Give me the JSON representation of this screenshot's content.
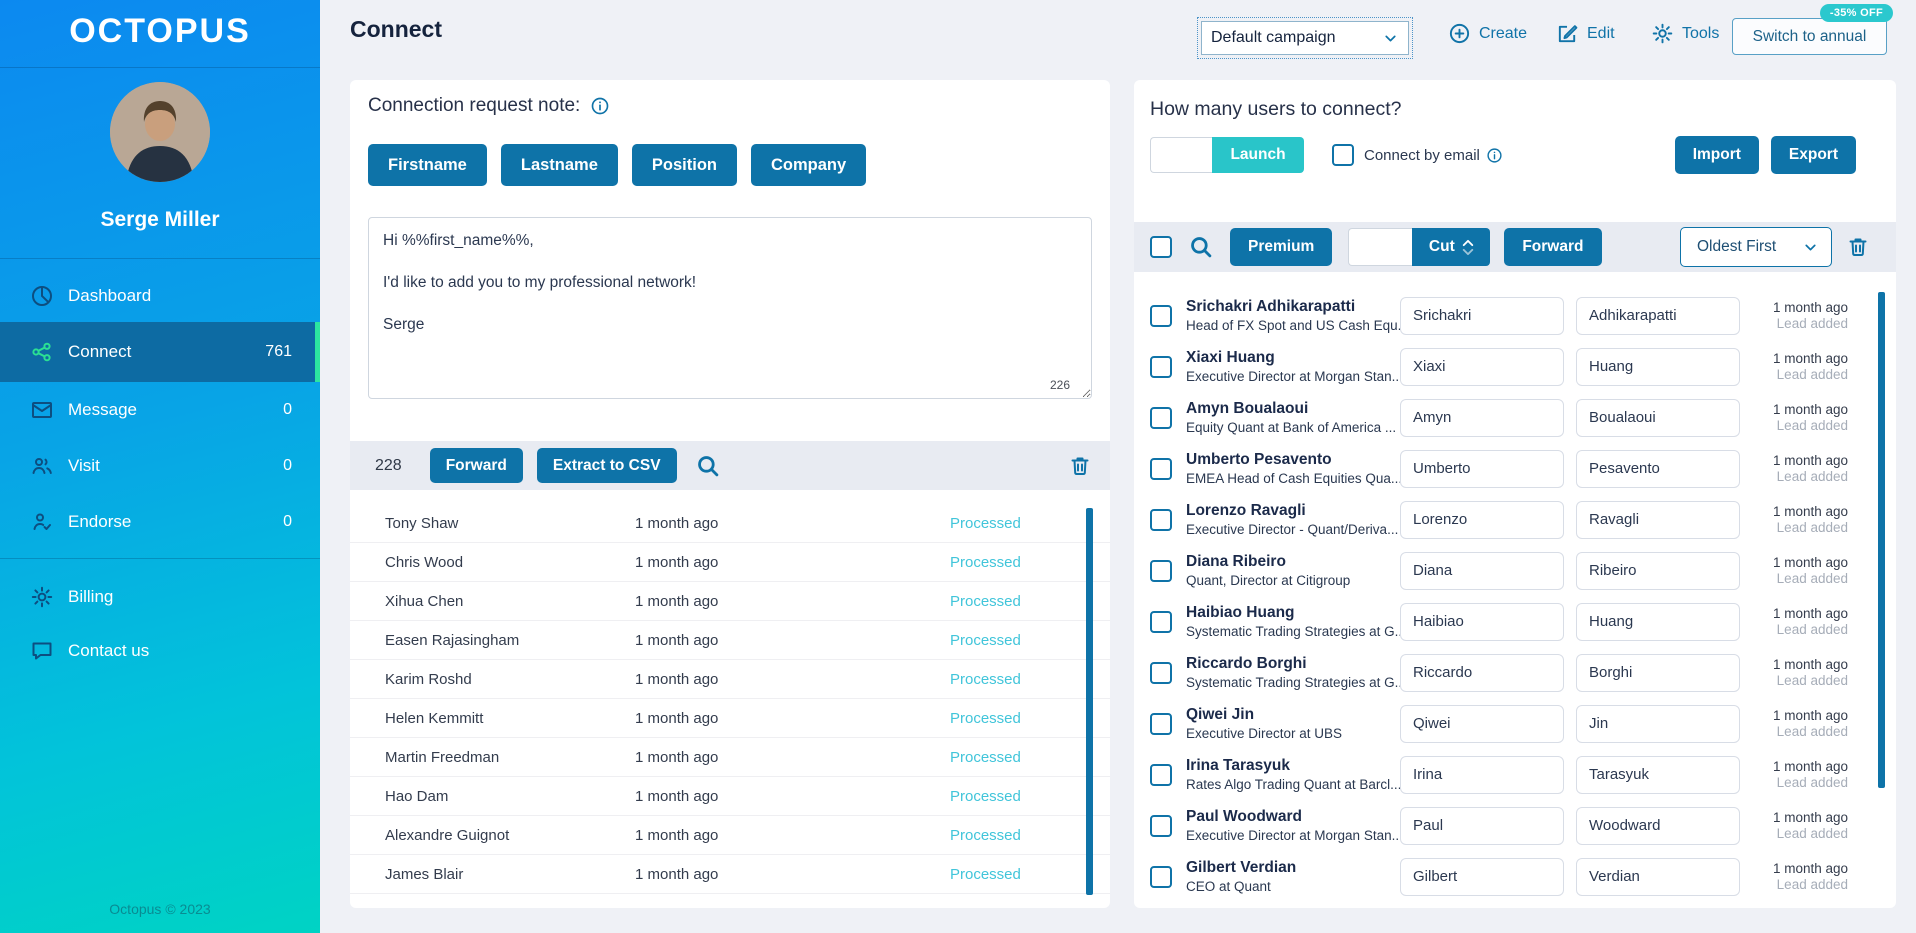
{
  "app": {
    "logo": "OCTOPUS",
    "footer": "Octopus © 2023"
  },
  "sidebar": {
    "user": "Serge Miller",
    "items": [
      {
        "label": "Dashboard",
        "count": ""
      },
      {
        "label": "Connect",
        "count": "761"
      },
      {
        "label": "Message",
        "count": "0"
      },
      {
        "label": "Visit",
        "count": "0"
      },
      {
        "label": "Endorse",
        "count": "0"
      }
    ],
    "secondary": [
      {
        "label": "Billing"
      },
      {
        "label": "Contact us"
      }
    ]
  },
  "header": {
    "title": "Connect",
    "campaign_select": "Default campaign",
    "create_label": "Create",
    "edit_label": "Edit",
    "tools_label": "Tools",
    "switch_annual_label": "Switch to annual",
    "discount_badge": "-35% OFF"
  },
  "note_panel": {
    "title": "Connection request note:",
    "variables": [
      "Firstname",
      "Lastname",
      "Position",
      "Company"
    ],
    "message": "Hi %%first_name%%,\n\nI'd like to add you to my professional network!\n\nSerge",
    "char_count": "226"
  },
  "processed_panel": {
    "count": "228",
    "forward_label": "Forward",
    "extract_label": "Extract to CSV",
    "rows": [
      {
        "name": "Tony Shaw",
        "time": "1 month ago",
        "status": "Processed"
      },
      {
        "name": "Chris Wood",
        "time": "1 month ago",
        "status": "Processed"
      },
      {
        "name": "Xihua Chen",
        "time": "1 month ago",
        "status": "Processed"
      },
      {
        "name": "Easen Rajasingham",
        "time": "1 month ago",
        "status": "Processed"
      },
      {
        "name": "Karim Roshd",
        "time": "1 month ago",
        "status": "Processed"
      },
      {
        "name": "Helen Kemmitt",
        "time": "1 month ago",
        "status": "Processed"
      },
      {
        "name": "Martin Freedman",
        "time": "1 month ago",
        "status": "Processed"
      },
      {
        "name": "Hao Dam",
        "time": "1 month ago",
        "status": "Processed"
      },
      {
        "name": "Alexandre Guignot",
        "time": "1 month ago",
        "status": "Processed"
      },
      {
        "name": "James Blair",
        "time": "1 month ago",
        "status": "Processed"
      }
    ]
  },
  "connect_panel": {
    "title": "How many users to connect?",
    "launch_label": "Launch",
    "connect_by_email_label": "Connect by email",
    "import_label": "Import",
    "export_label": "Export",
    "premium_label": "Premium",
    "cut_label": "Cut",
    "forward_label": "Forward",
    "sort_value": "Oldest First",
    "contacts": [
      {
        "name": "Srichakri Adhikarapatti",
        "title": "Head of FX Spot and US Cash Equ...",
        "first": "Srichakri",
        "last": "Adhikarapatti",
        "time": "1 month ago",
        "status": "Lead added"
      },
      {
        "name": "Xiaxi Huang",
        "title": "Executive Director at Morgan Stan...",
        "first": "Xiaxi",
        "last": "Huang",
        "time": "1 month ago",
        "status": "Lead added"
      },
      {
        "name": "Amyn Boualaoui",
        "title": "Equity Quant at Bank of America ...",
        "first": "Amyn",
        "last": "Boualaoui",
        "time": "1 month ago",
        "status": "Lead added"
      },
      {
        "name": "Umberto Pesavento",
        "title": "EMEA Head of Cash Equities Qua...",
        "first": "Umberto",
        "last": "Pesavento",
        "time": "1 month ago",
        "status": "Lead added"
      },
      {
        "name": "Lorenzo Ravagli",
        "title": "Executive Director - Quant/Deriva...",
        "first": "Lorenzo",
        "last": "Ravagli",
        "time": "1 month ago",
        "status": "Lead added"
      },
      {
        "name": "Diana Ribeiro",
        "title": "Quant, Director at Citigroup",
        "first": "Diana",
        "last": "Ribeiro",
        "time": "1 month ago",
        "status": "Lead added"
      },
      {
        "name": "Haibiao Huang",
        "title": "Systematic Trading Strategies at G...",
        "first": "Haibiao",
        "last": "Huang",
        "time": "1 month ago",
        "status": "Lead added"
      },
      {
        "name": "Riccardo Borghi",
        "title": "Systematic Trading Strategies at G...",
        "first": "Riccardo",
        "last": "Borghi",
        "time": "1 month ago",
        "status": "Lead added"
      },
      {
        "name": "Qiwei Jin",
        "title": "Executive Director at UBS",
        "first": "Qiwei",
        "last": "Jin",
        "time": "1 month ago",
        "status": "Lead added"
      },
      {
        "name": "Irina Tarasyuk",
        "title": "Rates Algo Trading Quant at Barcl...",
        "first": "Irina",
        "last": "Tarasyuk",
        "time": "1 month ago",
        "status": "Lead added"
      },
      {
        "name": "Paul Woodward",
        "title": "Executive Director at Morgan Stan...",
        "first": "Paul",
        "last": "Woodward",
        "time": "1 month ago",
        "status": "Lead added"
      },
      {
        "name": "Gilbert Verdian",
        "title": "CEO at Quant",
        "first": "Gilbert",
        "last": "Verdian",
        "time": "1 month ago",
        "status": "Lead added"
      }
    ]
  },
  "colors": {
    "primary_blue": "#0e73a8",
    "teal": "#29c5c9",
    "badge_teal": "#2bc8ce",
    "active_item": "#0d6ba3",
    "green_accent": "#2ce6a0",
    "processed": "#41c5da",
    "sidebar_gradient_top": "#0c89f0",
    "sidebar_gradient_bottom": "#00d3c4"
  }
}
